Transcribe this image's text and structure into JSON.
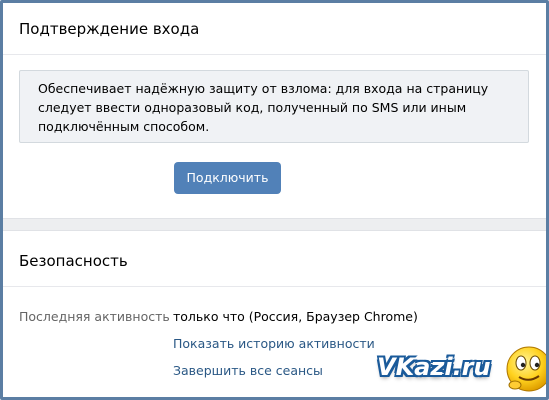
{
  "login_confirmation": {
    "title": "Подтверждение входа",
    "description": "Обеспечивает надёжную защиту от взлома: для входа на страницу следует ввести одноразовый код, полученный по SMS или иным подключённым способом.",
    "connect_label": "Подключить"
  },
  "security": {
    "title": "Безопасность",
    "last_activity_label": "Последняя активность",
    "last_activity_value": "только что (Россия, Браузер Chrome)",
    "show_history_link": "Показать историю активности",
    "end_sessions_link": "Завершить все сеансы"
  },
  "watermark": {
    "text": "VKazi.ru"
  },
  "colors": {
    "accent": "#5181b8",
    "link": "#2a5885",
    "frame": "#5b7ea3"
  }
}
